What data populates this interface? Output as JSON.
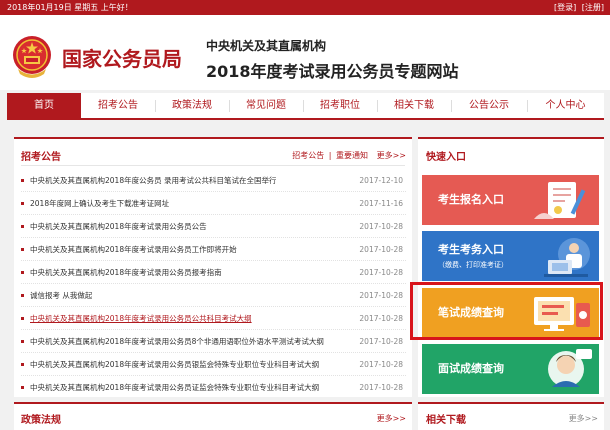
{
  "topbar": {
    "date": "2018年01月19日  星期五  上午好！",
    "login": "[登录]",
    "register": "[注册]"
  },
  "header": {
    "bureau": "国家公务员局",
    "subtitle1": "中央机关及其直属机构",
    "subtitle2": "2018年度考试录用公务员专题网站"
  },
  "nav": [
    "首页",
    "招考公告",
    "政策法规",
    "常见问题",
    "招考职位",
    "相关下载",
    "公告公示",
    "个人中心"
  ],
  "notices": {
    "title": "招考公告",
    "tab1": "招考公告",
    "sep": "|",
    "tab2": "重要通知",
    "more": "更多>>",
    "items": [
      {
        "title": "中央机关及其直属机构2018年度公务员 录用考试公共科目笔试在全国举行",
        "date": "2017-12-10"
      },
      {
        "title": "2018年度网上确认及考生下载准考证网址",
        "date": "2017-11-16"
      },
      {
        "title": "中央机关及其直属机构2018年度考试录用公务员公告",
        "date": "2017-10-28"
      },
      {
        "title": "中央机关及其直属机构2018年度考试录用公务员工作即将开始",
        "date": "2017-10-28"
      },
      {
        "title": "中央机关及其直属机构2018年度考试录用公务员报考指南",
        "date": "2017-10-28"
      },
      {
        "title": "诚信报考  从我做起",
        "date": "2017-10-28"
      },
      {
        "title": "中央机关及其直属机构2018年度考试录用公务员公共科目考试大纲",
        "date": "2017-10-28"
      },
      {
        "title": "中央机关及其直属机构2018年度考试录用公务员8个非通用语职位外语水平测试考试大纲",
        "date": "2017-10-28"
      },
      {
        "title": "中央机关及其直属机构2018年度考试录用公务员银监会特殊专业职位专业科目考试大纲",
        "date": "2017-10-28"
      },
      {
        "title": "中央机关及其直属机构2018年度考试录用公务员证监会特殊专业职位专业科目考试大纲",
        "date": "2017-10-28"
      }
    ]
  },
  "policy": {
    "title": "政策法规",
    "more": "更多>>"
  },
  "quick": {
    "title": "快速入口",
    "register": "考生报名入口",
    "exam": "考生考务入口",
    "exam_sub": "（缴费、打印准考证）",
    "score": "笔试成绩查询",
    "interview": "面试成绩查询"
  },
  "downloads": {
    "title": "相关下载",
    "more": "更多>>"
  },
  "colors": {
    "brand": "#b0191e",
    "register": "#e55a53",
    "exam": "#2f74c7",
    "score": "#f0a021",
    "interview": "#21a467"
  }
}
